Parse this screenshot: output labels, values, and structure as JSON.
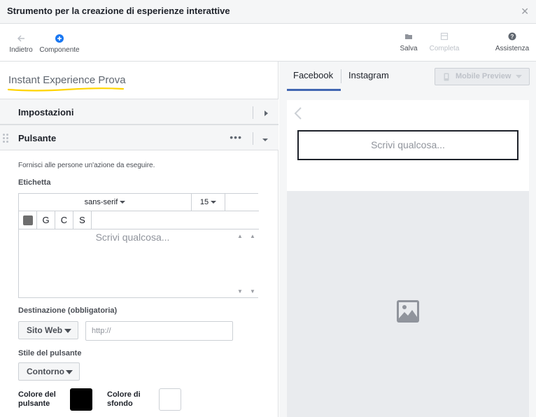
{
  "window": {
    "title": "Strumento per la creazione di esperienze interattive",
    "close_icon": "close-icon"
  },
  "toolbar": {
    "back_label": "Indietro",
    "component_label": "Componente",
    "save_label": "Salva",
    "complete_label": "Completa",
    "help_label": "Assistenza"
  },
  "experience": {
    "name": "Instant Experience Prova",
    "underline_color": "#ffd400"
  },
  "sections": {
    "settings_label": "Impostazioni",
    "button_label": "Pulsante"
  },
  "button_panel": {
    "hint": "Fornisci alle persone un'azione da eseguire.",
    "label_title": "Etichetta",
    "font_family": "sans-serif",
    "font_size": "15",
    "format_bold": "G",
    "format_italic": "C",
    "format_underline": "S",
    "text_placeholder": "Scrivi qualcosa...",
    "destination_title": "Destinazione (obbligatoria)",
    "destination_type": "Sito Web",
    "url_placeholder": "http://",
    "style_title": "Stile del pulsante",
    "style_value": "Contorno",
    "button_color_label_1": "Colore del",
    "button_color_label_2": "pulsante",
    "button_color": "#000000",
    "bg_color_label_1": "Colore di",
    "bg_color_label_2": "sfondo",
    "bg_color": "#ffffff"
  },
  "preview": {
    "tab_facebook": "Facebook",
    "tab_instagram": "Instagram",
    "mobile_preview_label": "Mobile Preview",
    "button_text": "Scrivi qualcosa...",
    "accent_color": "#4267b2"
  }
}
